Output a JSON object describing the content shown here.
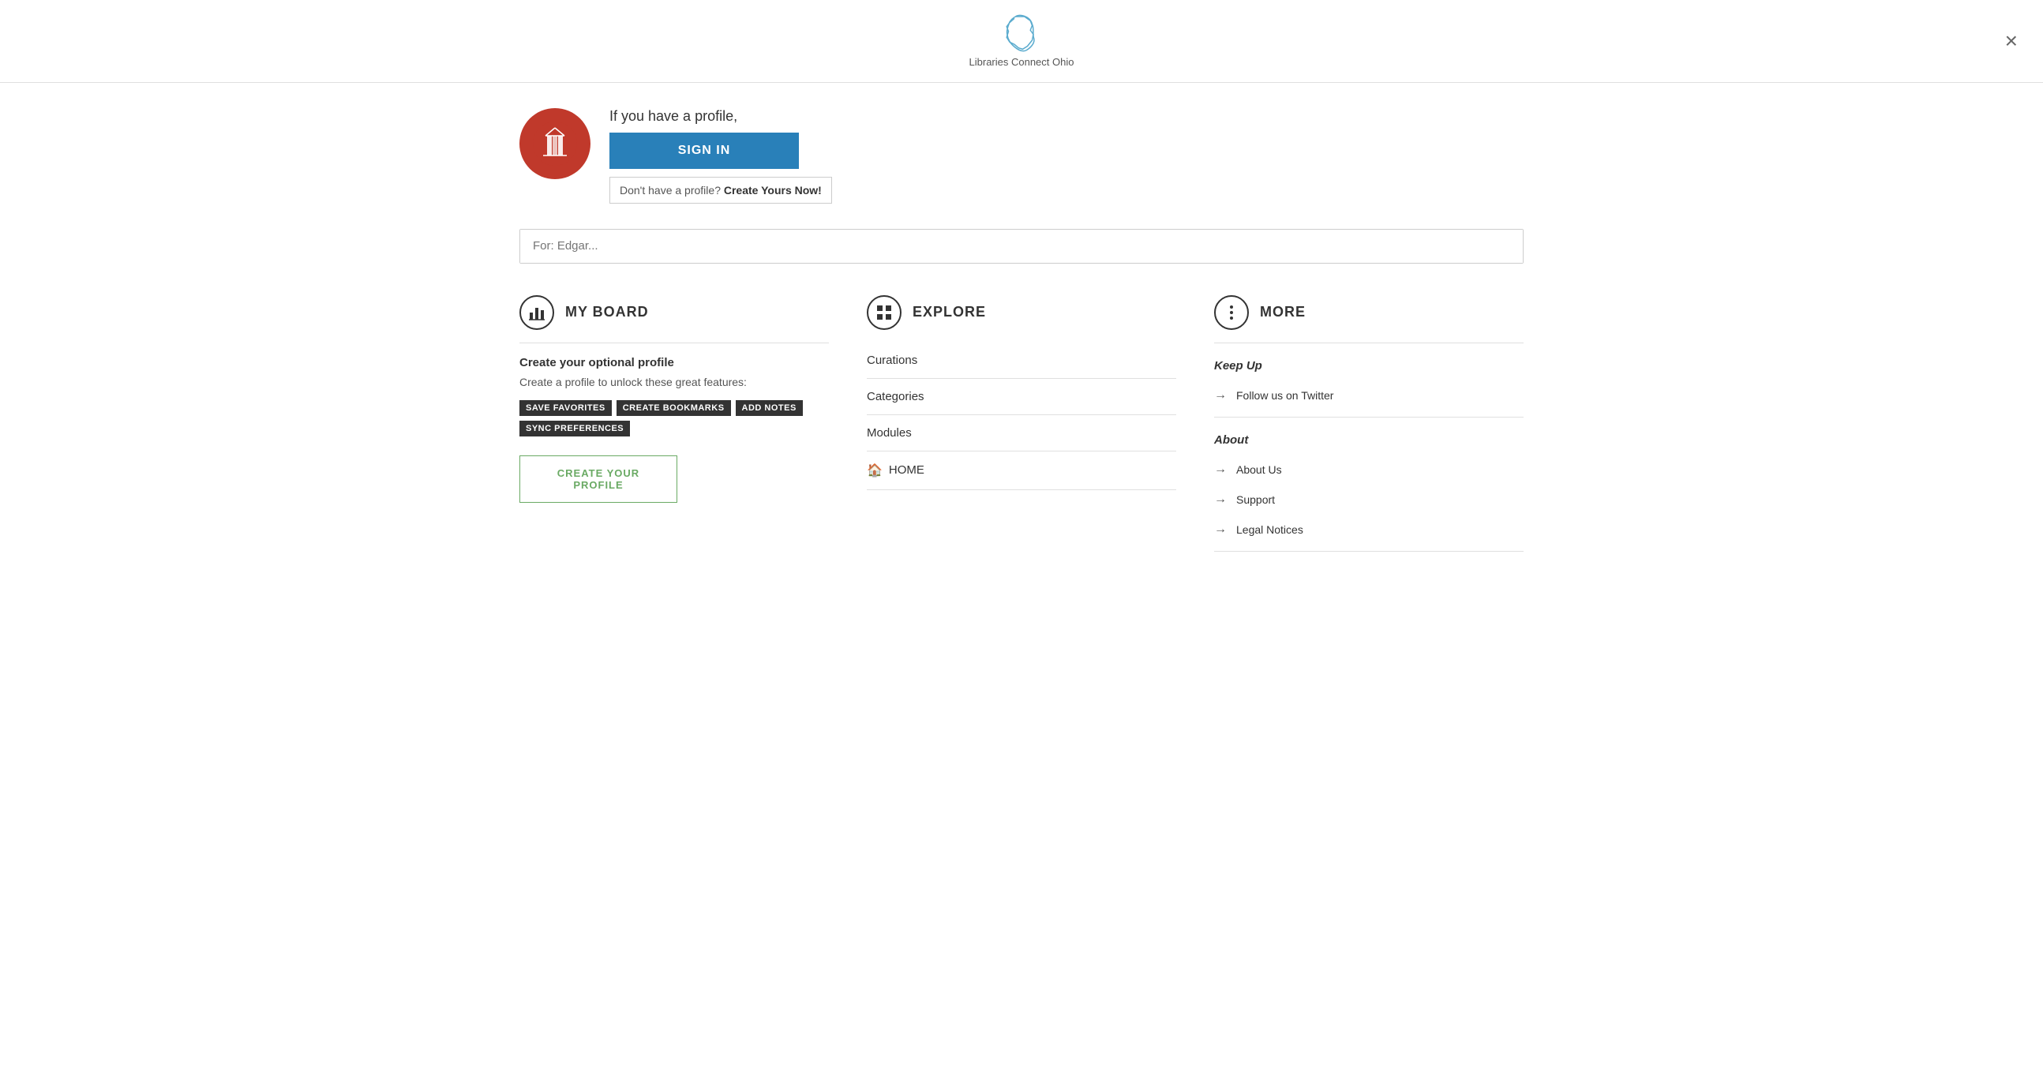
{
  "app": {
    "name": "Libraries Connect Ohio",
    "logo_alt": "Libraries Connect Ohio logo"
  },
  "header": {
    "close_label": "×"
  },
  "sign_in": {
    "prompt": "If you have a profile,",
    "button_label": "SIGN IN",
    "no_profile_text": "Don't have a profile?",
    "create_link_label": "Create Yours Now!"
  },
  "search": {
    "placeholder": "For: Edgar..."
  },
  "my_board": {
    "section_title": "MY BOARD",
    "subtitle": "Create your optional profile",
    "description": "Create a profile to unlock these great features:",
    "tags": [
      "SAVE FAVORITES",
      "CREATE BOOKMARKS",
      "ADD NOTES",
      "SYNC PREFERENCES"
    ],
    "create_button_label": "CREATE YOUR PROFILE"
  },
  "explore": {
    "section_title": "EXPLORE",
    "nav_items": [
      {
        "label": "Curations",
        "icon": ""
      },
      {
        "label": "Categories",
        "icon": ""
      },
      {
        "label": "Modules",
        "icon": ""
      },
      {
        "label": "HOME",
        "icon": "🏠"
      }
    ]
  },
  "more": {
    "section_title": "MORE",
    "keep_up_label": "Keep Up",
    "keep_up_links": [
      {
        "label": "Follow us on Twitter"
      }
    ],
    "about_label": "About",
    "about_links": [
      {
        "label": "About Us"
      },
      {
        "label": "Support"
      },
      {
        "label": "Legal Notices"
      }
    ]
  }
}
